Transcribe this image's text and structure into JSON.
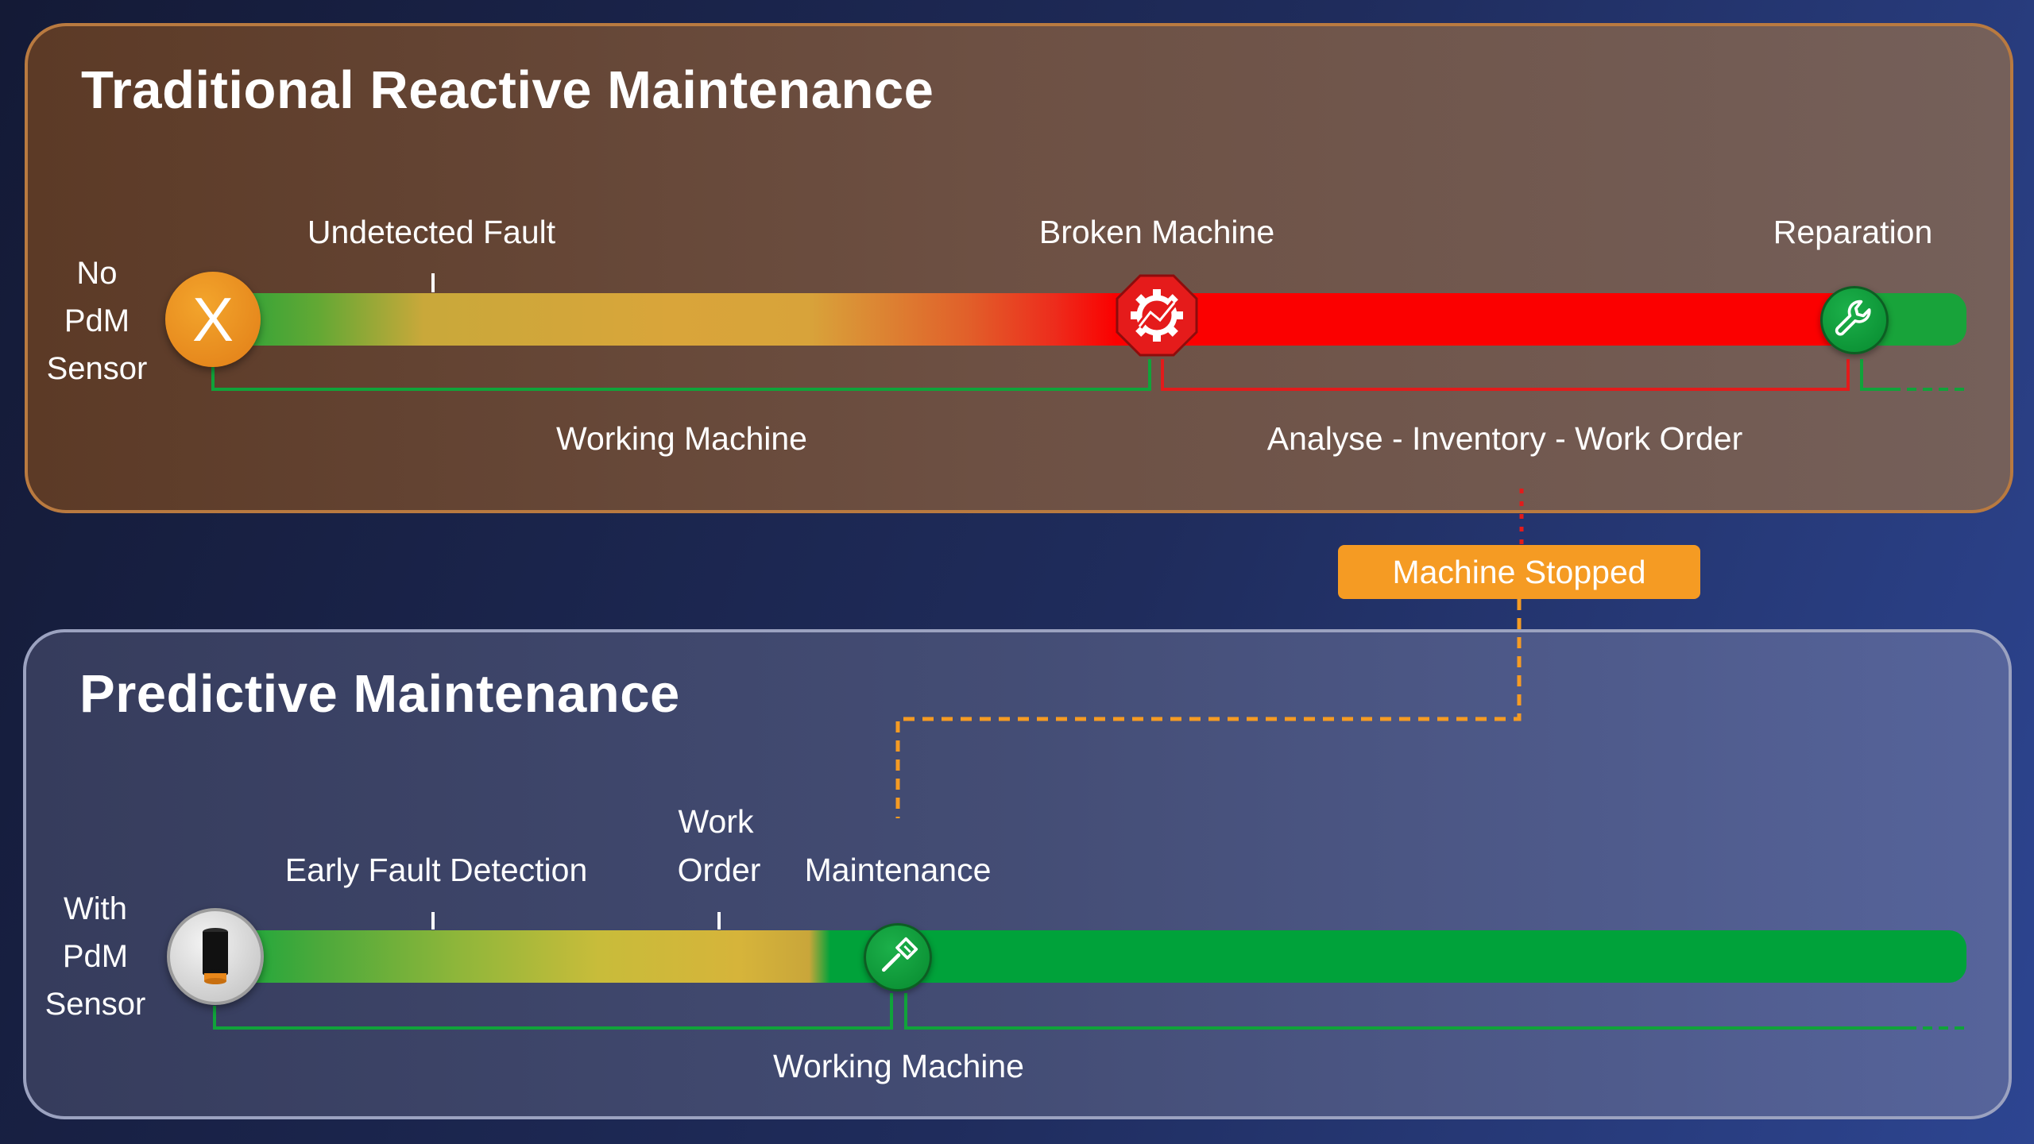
{
  "top_panel": {
    "title": "Traditional Reactive Maintenance",
    "side_label": [
      "No",
      "PdM",
      "Sensor"
    ],
    "milestones": {
      "undetected_fault": "Undetected Fault",
      "broken_machine": "Broken Machine",
      "reparation": "Reparation"
    },
    "spans": {
      "working": "Working Machine",
      "downtime": "Analyse - Inventory - Work Order"
    },
    "icons": {
      "start": "no-sensor-x-icon",
      "broken": "broken-gear-stop-icon",
      "end": "wrench-icon"
    },
    "x_mark": "X"
  },
  "badge": {
    "label": "Machine Stopped"
  },
  "bottom_panel": {
    "title": "Predictive Maintenance",
    "side_label": [
      "With",
      "PdM",
      "Sensor"
    ],
    "milestones": {
      "early_fault": "Early Fault Detection",
      "work_order_line1": "Work",
      "work_order_line2": "Order",
      "maintenance": "Maintenance"
    },
    "spans": {
      "working": "Working Machine"
    },
    "icons": {
      "start": "pdm-sensor-icon",
      "maintenance": "screwdriver-icon"
    }
  },
  "colors": {
    "green": "#00a23a",
    "red": "#fb0000",
    "orange": "#f59b23",
    "yellow": "#d8a33a",
    "top_border": "#b97a40",
    "bottom_border": "#9ba2c0"
  }
}
